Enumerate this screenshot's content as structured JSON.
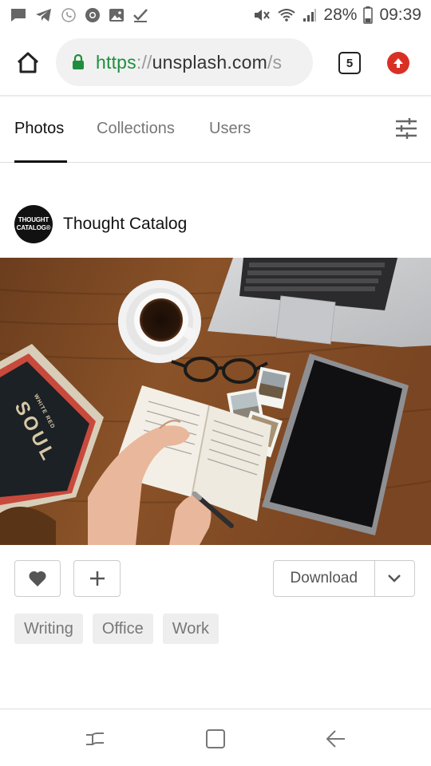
{
  "status_bar": {
    "battery": "28%",
    "time": "09:39",
    "icons_left": [
      "message-icon",
      "telegram-icon",
      "whatsapp-icon",
      "chrome-icon",
      "image-icon",
      "check-icon"
    ],
    "icons_right": [
      "mute-icon",
      "wifi-icon",
      "signal-icon",
      "battery-icon"
    ]
  },
  "browser": {
    "url_scheme": "https",
    "url_sep": "://",
    "url_host": "unsplash.com",
    "url_rest": "/s",
    "tab_count": "5"
  },
  "tabs": [
    {
      "label": "Photos",
      "active": true
    },
    {
      "label": "Collections",
      "active": false
    },
    {
      "label": "Users",
      "active": false
    }
  ],
  "author": {
    "name": "Thought Catalog",
    "avatar_line1": "THOUGHT",
    "avatar_line2": "CATALOG®"
  },
  "photo": {
    "book_text": "SOUL",
    "book_small_text": "WHITE RED"
  },
  "actions": {
    "download_label": "Download"
  },
  "tags": [
    "Writing",
    "Office",
    "Work"
  ],
  "colors": {
    "url_scheme": "#1e8e3e",
    "lock": "#1e8e3e",
    "update_badge": "#d93025",
    "tag_bg": "#eeeeee"
  }
}
